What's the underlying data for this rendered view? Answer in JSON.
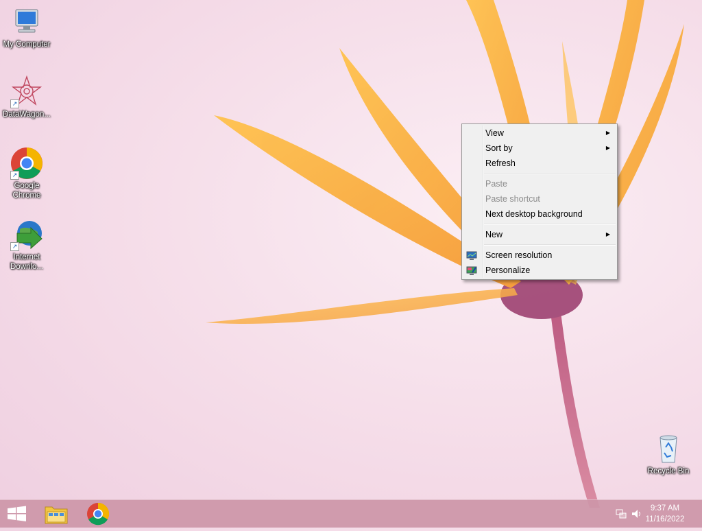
{
  "desktop": {
    "icons": [
      {
        "label": "My Computer",
        "icon": "my-computer-icon"
      },
      {
        "label": "DataWagon...",
        "icon": "datawagon-icon"
      },
      {
        "label": "Google Chrome",
        "icon": "google-chrome-icon"
      },
      {
        "label": "Internet Downlo...",
        "icon": "internet-download-manager-icon"
      },
      {
        "label": "Recycle Bin",
        "icon": "recycle-bin-icon"
      }
    ]
  },
  "context_menu": {
    "view": "View",
    "sort_by": "Sort by",
    "refresh": "Refresh",
    "paste": "Paste",
    "paste_shortcut": "Paste shortcut",
    "next_background": "Next desktop background",
    "new": "New",
    "screen_resolution": "Screen resolution",
    "personalize": "Personalize"
  },
  "taskbar": {
    "start": "windows-logo-icon",
    "pinned": [
      "file-explorer-icon",
      "google-chrome-icon"
    ],
    "tray": [
      "network-icon",
      "volume-icon"
    ],
    "time": "9:37 AM",
    "date": "11/16/2022"
  },
  "colors": {
    "taskbar": "#cd96a8",
    "menu_bg": "#f0f0f0",
    "petal": "#f7a733"
  }
}
